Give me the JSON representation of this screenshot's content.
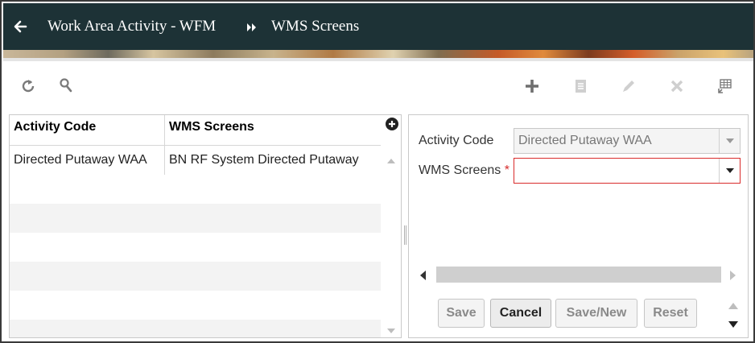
{
  "header": {
    "breadcrumb_parent": "Work Area Activity - WFM",
    "breadcrumb_current": "WMS Screens"
  },
  "table": {
    "columns": [
      "Activity Code",
      "WMS Screens"
    ],
    "rows": [
      {
        "activity_code": "Directed Putaway WAA",
        "wms_screens": "BN RF System Directed Putaway"
      }
    ]
  },
  "form": {
    "activity_code_label": "Activity Code",
    "activity_code_value": "Directed Putaway WAA",
    "wms_screens_label": "WMS Screens",
    "wms_screens_value": "",
    "required_marker": "*"
  },
  "buttons": {
    "save": "Save",
    "cancel": "Cancel",
    "save_new": "Save/New",
    "reset": "Reset"
  },
  "colors": {
    "header_bg": "#1d3236",
    "required": "#d62b2b",
    "icon_gray": "#7a7a7a",
    "icon_disabled": "#c4c4c4"
  },
  "icons": [
    "back-arrow-icon",
    "double-chevron-icon",
    "refresh-icon",
    "search-icon",
    "add-icon",
    "copy-icon",
    "edit-icon",
    "delete-icon",
    "column-settings-icon",
    "add-column-icon"
  ]
}
